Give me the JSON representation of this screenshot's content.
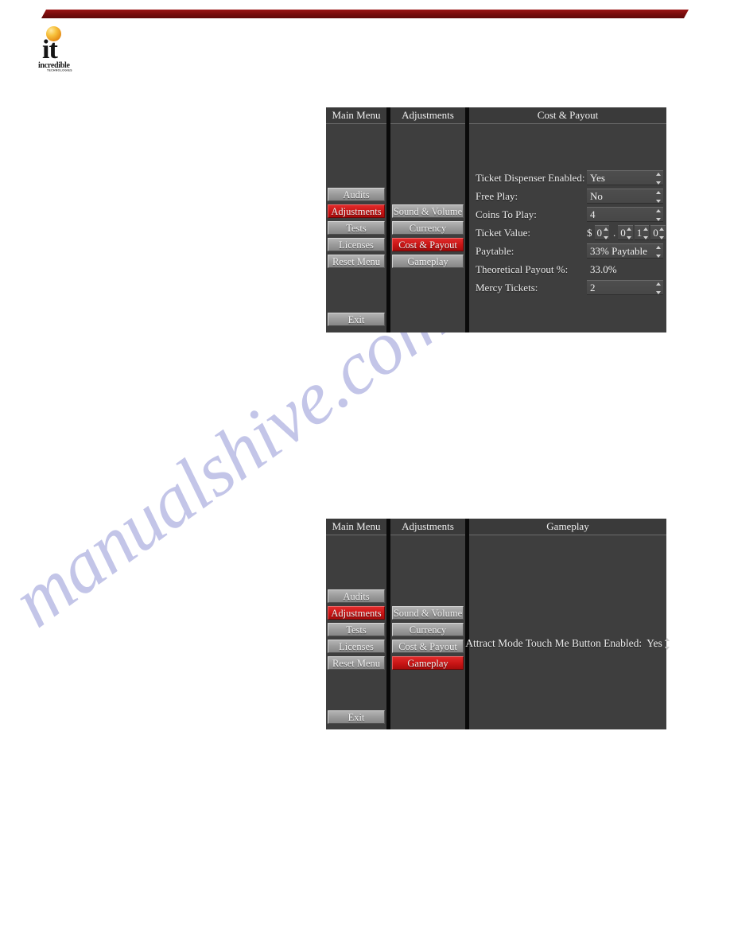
{
  "page": {
    "background_color": "#ffffff",
    "banner_color": "#7d0d0d",
    "watermark_text": "manualshive.com",
    "watermark_color": "#b9bce4"
  },
  "logo": {
    "name": "incredible-technologies-logo",
    "mark_text": "it",
    "wordmark": "incredible",
    "subwordmark": "TECHNOLOGIES",
    "ball_color": "#f7c23e"
  },
  "screens": [
    {
      "id": "cost-payout",
      "main_menu": {
        "header": "Main Menu",
        "items": [
          {
            "label": "Audits",
            "selected": false
          },
          {
            "label": "Adjustments",
            "selected": true
          },
          {
            "label": "Tests",
            "selected": false
          },
          {
            "label": "Licenses",
            "selected": false
          },
          {
            "label": "Reset Menu",
            "selected": false
          }
        ],
        "exit_label": "Exit"
      },
      "submenu": {
        "header": "Adjustments",
        "items": [
          {
            "label": "Sound & Volume",
            "selected": false
          },
          {
            "label": "Currency",
            "selected": false
          },
          {
            "label": "Cost & Payout",
            "selected": true
          },
          {
            "label": "Gameplay",
            "selected": false
          }
        ]
      },
      "detail": {
        "header": "Cost & Payout",
        "rows": [
          {
            "label": "Ticket Dispenser Enabled:",
            "value": "Yes",
            "spinner": true,
            "field": true
          },
          {
            "label": "Free Play:",
            "value": "No",
            "spinner": true,
            "field": true
          },
          {
            "label": "Coins To Play:",
            "value": "4",
            "spinner": true,
            "field": true
          },
          {
            "label": "Ticket Value:",
            "value": "$ 0 . 0 1 0",
            "spinner": true,
            "field": true,
            "kind": "currency",
            "currency_symbol": "$",
            "digits": [
              "0",
              "0",
              "1",
              "0"
            ],
            "decimal_after": 1
          },
          {
            "label": "Paytable:",
            "value": "33% Paytable",
            "spinner": true,
            "field": true
          },
          {
            "label": "Theoretical Payout %:",
            "value": "33.0%",
            "spinner": false,
            "field": false
          },
          {
            "label": "Mercy Tickets:",
            "value": "2",
            "spinner": true,
            "field": true
          }
        ]
      }
    },
    {
      "id": "gameplay",
      "main_menu": {
        "header": "Main Menu",
        "items": [
          {
            "label": "Audits",
            "selected": false
          },
          {
            "label": "Adjustments",
            "selected": true
          },
          {
            "label": "Tests",
            "selected": false
          },
          {
            "label": "Licenses",
            "selected": false
          },
          {
            "label": "Reset Menu",
            "selected": false
          }
        ],
        "exit_label": "Exit"
      },
      "submenu": {
        "header": "Adjustments",
        "items": [
          {
            "label": "Sound & Volume",
            "selected": false
          },
          {
            "label": "Currency",
            "selected": false
          },
          {
            "label": "Cost & Payout",
            "selected": false
          },
          {
            "label": "Gameplay",
            "selected": true
          }
        ]
      },
      "detail": {
        "header": "Gameplay",
        "rows": [
          {
            "label": "Attract Mode Touch Me Button Enabled:",
            "value": "Yes",
            "spinner": true,
            "field": false
          }
        ]
      }
    }
  ]
}
